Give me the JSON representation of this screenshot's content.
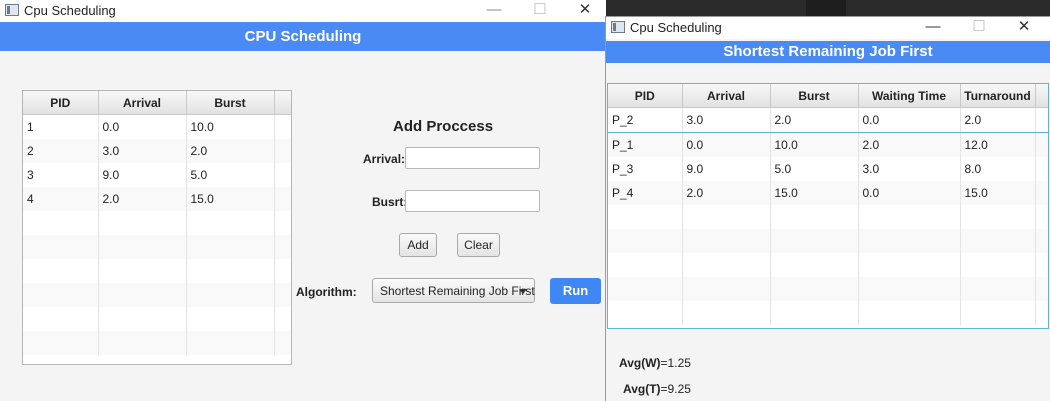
{
  "main_window": {
    "title": "Cpu Scheduling",
    "banner": "CPU Scheduling",
    "controls": {
      "minimize": "—",
      "maximize": "☐",
      "close": "✕"
    },
    "process_table": {
      "columns": [
        "PID",
        "Arrival",
        "Burst"
      ],
      "rows": [
        [
          "1",
          "0.0",
          "10.0"
        ],
        [
          "2",
          "3.0",
          "2.0"
        ],
        [
          "3",
          "9.0",
          "5.0"
        ],
        [
          "4",
          "2.0",
          "15.0"
        ],
        [
          "",
          "",
          ""
        ],
        [
          "",
          "",
          ""
        ],
        [
          "",
          "",
          ""
        ],
        [
          "",
          "",
          ""
        ],
        [
          "",
          "",
          ""
        ],
        [
          "",
          "",
          ""
        ]
      ]
    },
    "add_form": {
      "heading": "Add Proccess",
      "arrival_label": "Arrival:",
      "arrival_value": "",
      "burst_label": "Busrt:",
      "burst_value": "",
      "add_button": "Add",
      "clear_button": "Clear"
    },
    "algorithm": {
      "label": "Algorithm:",
      "selected": "Shortest Remaining Job First",
      "run_button": "Run"
    }
  },
  "result_window": {
    "title": "Cpu Scheduling",
    "banner": "Shortest Remaining Job First",
    "controls": {
      "minimize": "—",
      "maximize": "☐",
      "close": "✕"
    },
    "results_table": {
      "columns": [
        "PID",
        "Arrival",
        "Burst",
        "Waiting Time",
        "Turnaround"
      ],
      "rows": [
        [
          "P_2",
          "3.0",
          "2.0",
          "0.0",
          "2.0"
        ],
        [
          "P_1",
          "0.0",
          "10.0",
          "2.0",
          "12.0"
        ],
        [
          "P_3",
          "9.0",
          "5.0",
          "3.0",
          "8.0"
        ],
        [
          "P_4",
          "2.0",
          "15.0",
          "0.0",
          "15.0"
        ],
        [
          "",
          "",
          "",
          "",
          ""
        ],
        [
          "",
          "",
          "",
          "",
          ""
        ],
        [
          "",
          "",
          "",
          "",
          ""
        ],
        [
          "",
          "",
          "",
          "",
          ""
        ],
        [
          "",
          "",
          "",
          "",
          ""
        ]
      ]
    },
    "avg_w_label": "Avg(W)",
    "avg_w_value": "=1.25",
    "avg_t_label": "Avg(T)",
    "avg_t_value": "=9.25"
  },
  "colors": {
    "banner": "#4a8af4",
    "run_button": "#3e87f5",
    "selection": "#5fb3d6"
  }
}
